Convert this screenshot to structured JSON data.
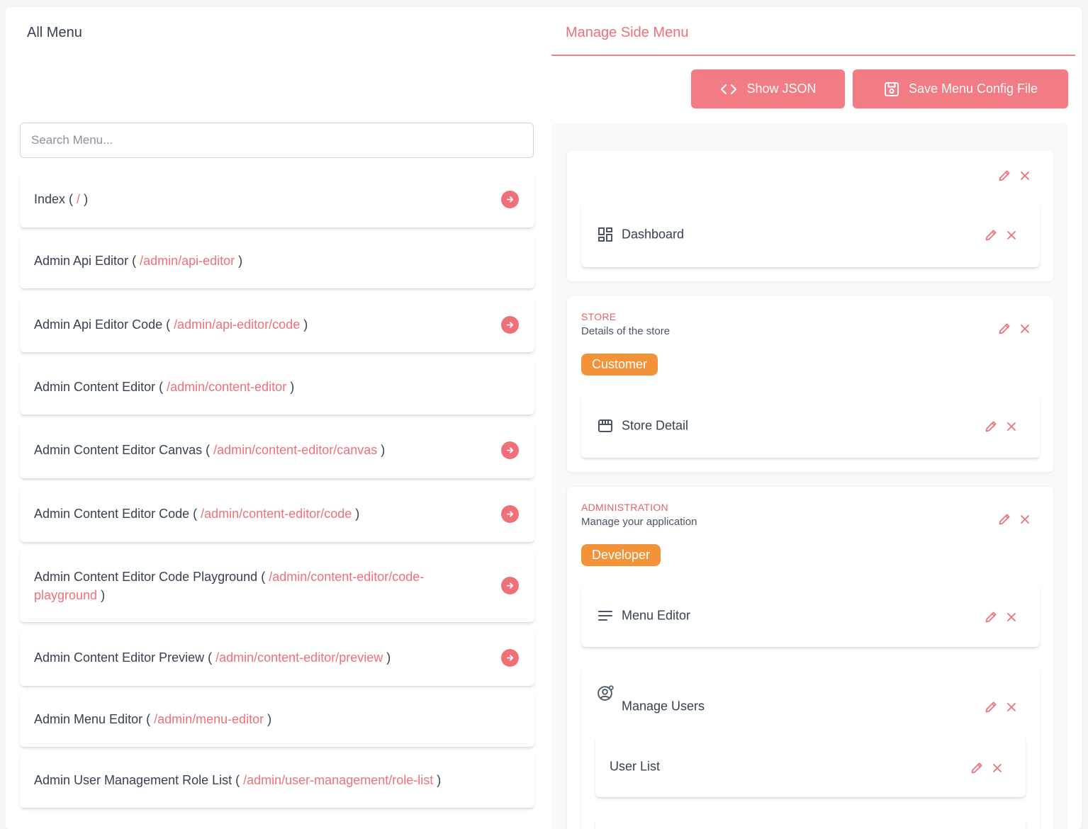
{
  "left": {
    "title": "All Menu",
    "search_placeholder": "Search Menu...",
    "items": [
      {
        "name": "Index",
        "path": "/",
        "has_arrow": true
      },
      {
        "name": "Admin Api Editor",
        "path": "/admin/api-editor",
        "has_arrow": false
      },
      {
        "name": "Admin Api Editor Code",
        "path": "/admin/api-editor/code",
        "has_arrow": true
      },
      {
        "name": "Admin Content Editor",
        "path": "/admin/content-editor",
        "has_arrow": false
      },
      {
        "name": "Admin Content Editor Canvas",
        "path": "/admin/content-editor/canvas",
        "has_arrow": true
      },
      {
        "name": "Admin Content Editor Code",
        "path": "/admin/content-editor/code",
        "has_arrow": true
      },
      {
        "name": "Admin Content Editor Code Playground",
        "path": "/admin/content-editor/code-playground",
        "has_arrow": true
      },
      {
        "name": "Admin Content Editor Preview",
        "path": "/admin/content-editor/preview",
        "has_arrow": true
      },
      {
        "name": "Admin Menu Editor",
        "path": "/admin/menu-editor",
        "has_arrow": false
      },
      {
        "name": "Admin User Management Role List",
        "path": "/admin/user-management/role-list",
        "has_arrow": false
      }
    ]
  },
  "right": {
    "tab_label": "Manage Side Menu",
    "show_json_label": "Show JSON",
    "save_label": "Save Menu Config File",
    "groups": [
      {
        "title": "",
        "description": "",
        "items": [
          {
            "label": "Dashboard",
            "icon": "dashboard-icon"
          }
        ]
      },
      {
        "title": "STORE",
        "description": "Details of the store",
        "badge": "Customer",
        "items": [
          {
            "label": "Store Detail",
            "icon": "store-icon"
          }
        ]
      },
      {
        "title": "ADMINISTRATION",
        "description": "Manage your application",
        "badge": "Developer",
        "items": [
          {
            "label": "Menu Editor",
            "icon": "menu-lines-icon"
          },
          {
            "label": "Manage Users",
            "icon": "user-settings-icon",
            "children": [
              {
                "label": "User List"
              }
            ]
          }
        ]
      }
    ]
  },
  "colors": {
    "accent": "#f0707a",
    "button_bg": "#f27b84",
    "badge_orange": "#f2933a",
    "text": "#374151"
  }
}
